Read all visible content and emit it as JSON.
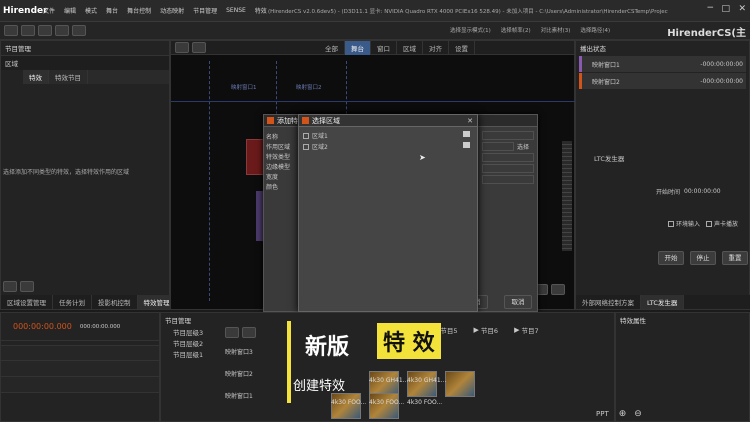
{
  "app": {
    "logo": "Hirender",
    "title": "(HirenderCS v2.0.6dev5) - (D3D11.1 显卡: NVIDIA Quadro RTX 4000 PCIEx16 528.49) - 未加入项目 - C:\\Users\\Administrator\\HirenderCSTemp\\ProjectCache_C\\aller 未保存",
    "brand_right": "HirenderCS(主"
  },
  "menu": [
    "文件",
    "编辑",
    "模式",
    "舞台",
    "舞台控制",
    "动态映射",
    "节目管理",
    "SENSE",
    "特效",
    "灯光",
    "窗口",
    "帮助",
    "工具",
    "工具",
    "选项"
  ],
  "top_right_menu": [
    "选择显示模式(1)",
    "选择帧率(2)",
    "对比素材(3)",
    "选择路径(4)"
  ],
  "left_panel": {
    "header": "节目管理",
    "field": "区域",
    "tabs": [
      "特效",
      "特效节目"
    ],
    "hint": "选择添加不同类型的特效，选择特效作用的区域",
    "bottom_tabs": [
      "区域设置管理",
      "任务计划",
      "投影机控制",
      "特效管理"
    ]
  },
  "stage_tabs": [
    "全部",
    "舞台",
    "窗口",
    "区域",
    "对齐",
    "设置"
  ],
  "stage": {
    "labels": [
      "映射窗口1",
      "映射窗口2",
      "映射窗口3"
    ]
  },
  "dialog_back": {
    "title": "添加特效",
    "rows": [
      "名称",
      "作用区域",
      "特效类型",
      "边缘模型",
      "宽度",
      "颜色"
    ],
    "values": [
      "特",
      "",
      "边",
      "静",
      "",
      ""
    ],
    "color_value": "#d2541a",
    "footer": [
      "全选",
      "确定",
      "取消",
      "取消"
    ]
  },
  "dialog_front": {
    "title": "选择区域",
    "items": [
      "区域1",
      "区域2"
    ],
    "side_button": "选择"
  },
  "right_panel": {
    "header": "播出状态",
    "entries": [
      {
        "name": "映射窗口1",
        "time": "-000:00:00:00"
      },
      {
        "name": "映射窗口2",
        "time": "-000:00:00:00"
      }
    ],
    "ltc": {
      "title": "LTC发生器",
      "start_label": "开始时间",
      "start_value": "00:00:00:00",
      "check1": "环境输入",
      "check2": "声卡播放",
      "btn_start": "开始",
      "btn_stop": "停止",
      "btn_reset": "重置"
    },
    "bottom_tabs": [
      "外部网络控制方案",
      "LTC发生器"
    ]
  },
  "timeline": {
    "time": "000:00:00.000",
    "cursor_time": "000:00:00.000"
  },
  "program": {
    "header": "节目管理",
    "programs": [
      "节目层级3",
      "节目层级2",
      "节目层级1"
    ],
    "windows": [
      "映射窗口3",
      "映射窗口2",
      "映射窗口1"
    ],
    "shows": [
      "节目5",
      "节目6",
      "节目7"
    ],
    "clips": [
      "4k30 GH41...",
      "4k30 GH41...",
      "4k30 FOO...",
      "4k30 FOO...",
      "4k30 FOO..."
    ],
    "overlay_title": "新版",
    "overlay_highlight": "特 效",
    "overlay_sub": "创建特效"
  },
  "effect_panel": {
    "header": "特效属性",
    "ppt": "PPT"
  }
}
